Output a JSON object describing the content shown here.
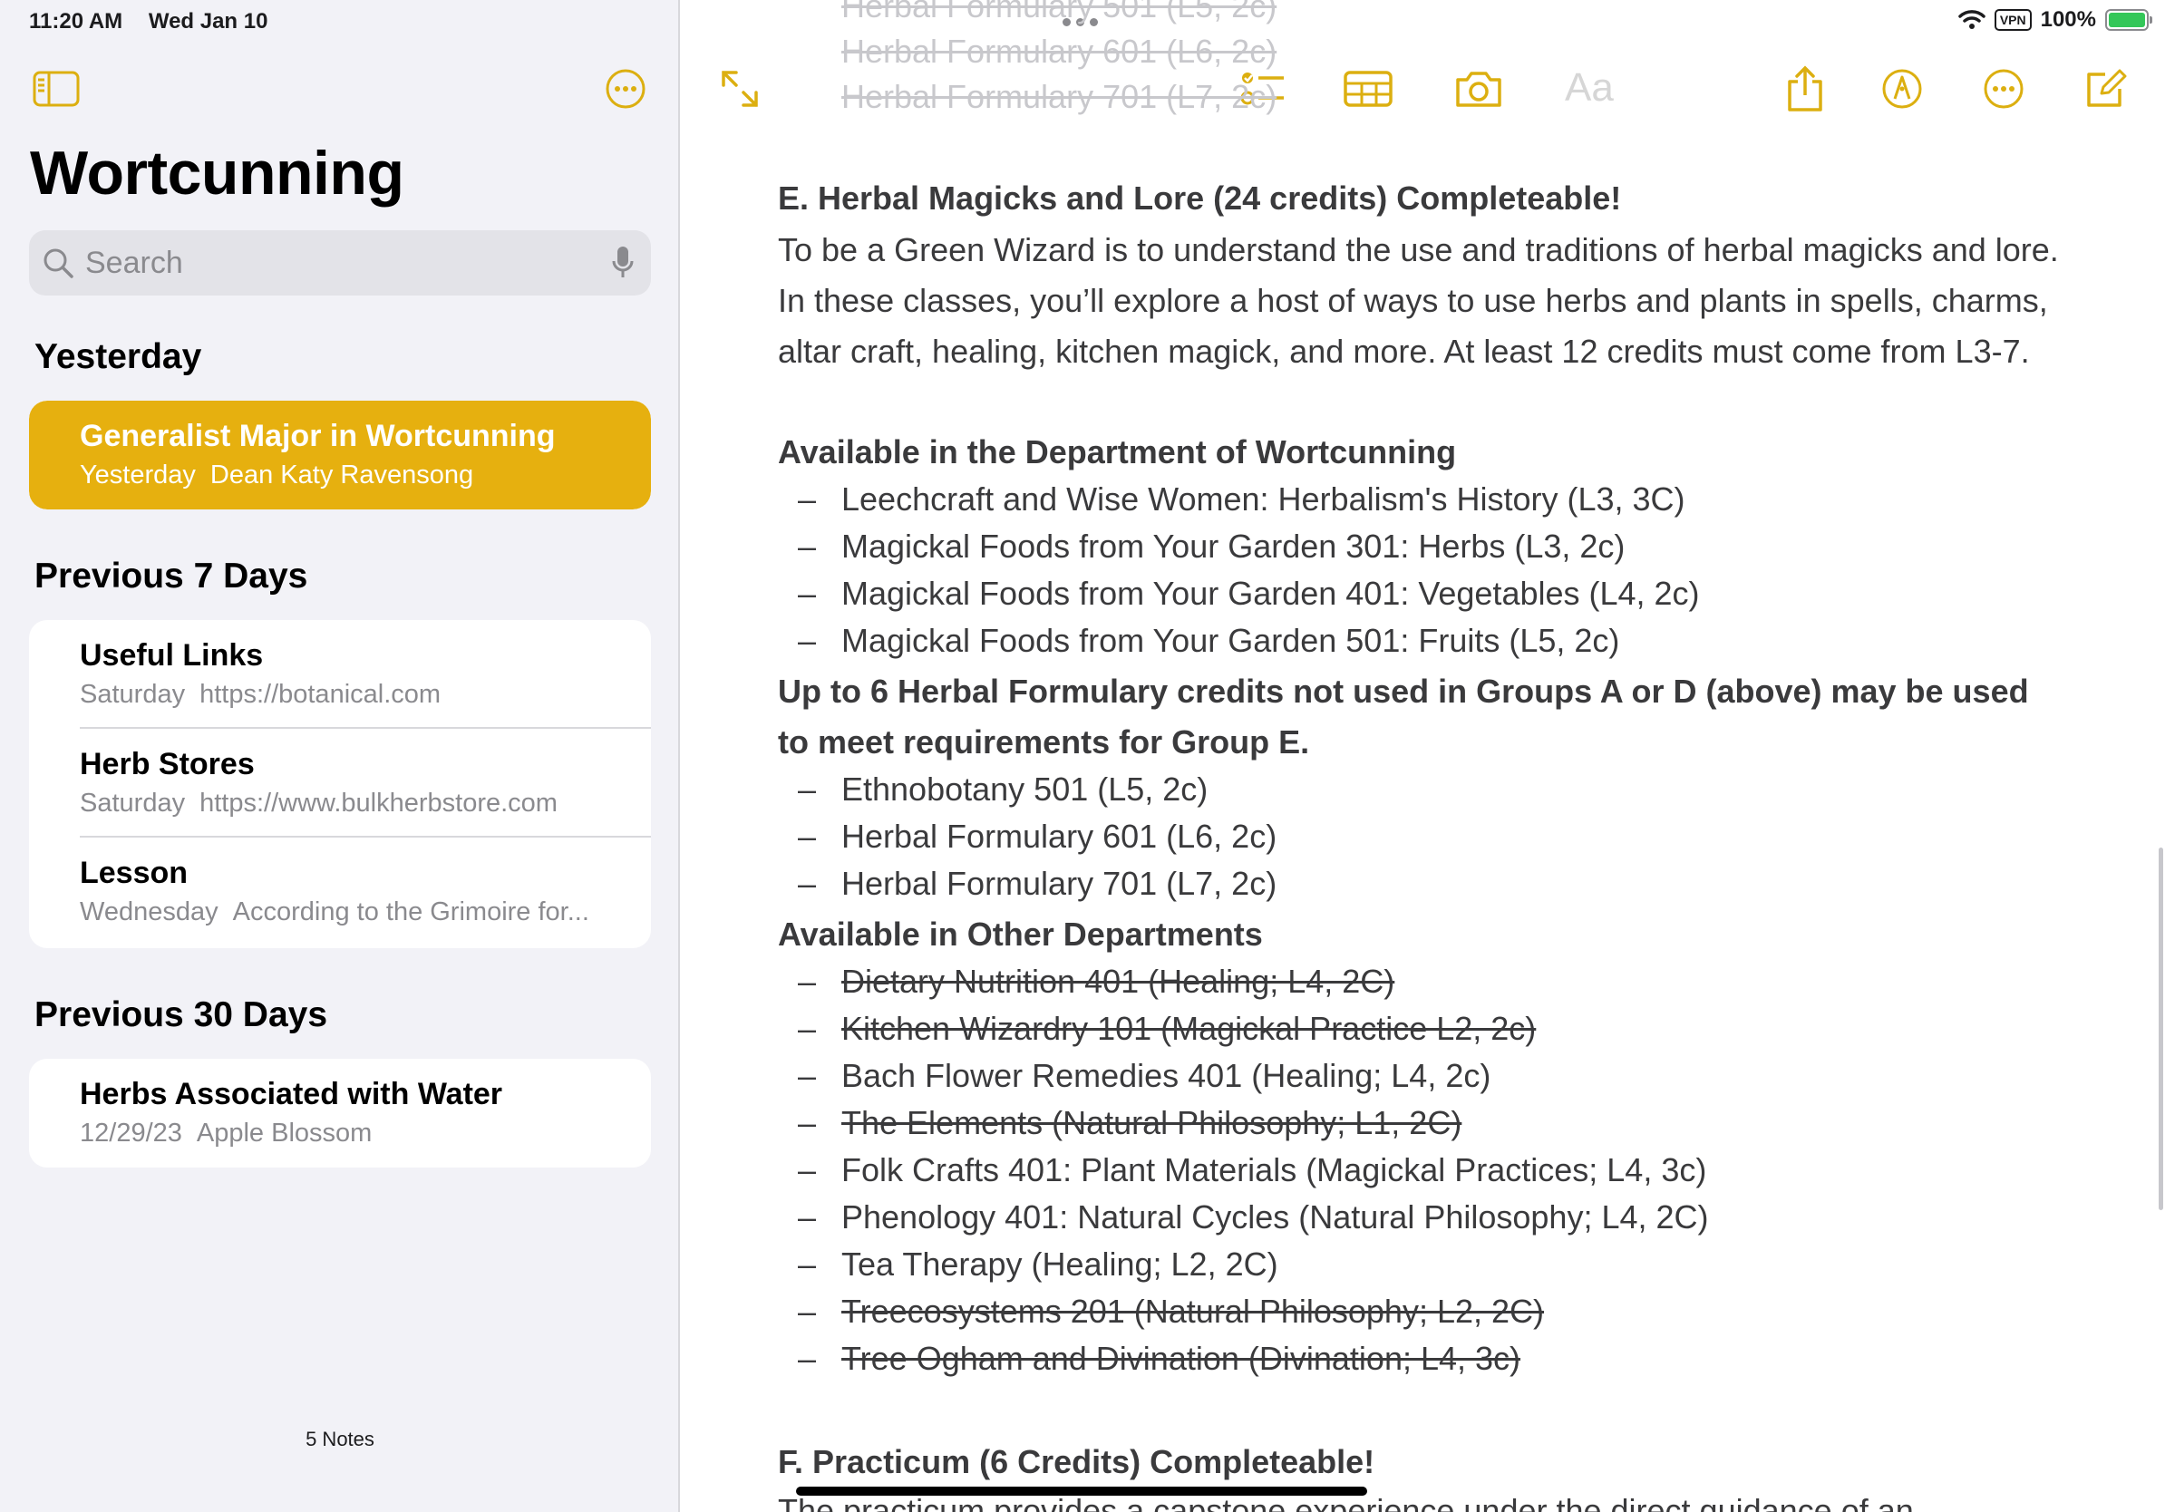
{
  "status": {
    "time": "11:20 AM",
    "date": "Wed Jan 10",
    "vpn": "VPN",
    "battery": "100%"
  },
  "sidebar": {
    "title": "Wortcunning",
    "search_placeholder": "Search",
    "sections": [
      {
        "heading": "Yesterday",
        "notes": [
          {
            "title": "Generalist Major in Wortcunning",
            "date": "Yesterday",
            "preview": "Dean Katy Ravensong",
            "selected": true
          }
        ]
      },
      {
        "heading": "Previous 7 Days",
        "notes": [
          {
            "title": "Useful Links",
            "date": "Saturday",
            "preview": "https://botanical.com"
          },
          {
            "title": "Herb Stores",
            "date": "Saturday",
            "preview": "https://www.bulkherbstore.com"
          },
          {
            "title": "Lesson",
            "date": "Wednesday",
            "preview": "According to the Grimoire for..."
          }
        ]
      },
      {
        "heading": "Previous 30 Days",
        "notes": [
          {
            "title": "Herbs Associated with Water",
            "date": "12/29/23",
            "preview": "Apple Blossom"
          }
        ]
      }
    ],
    "footer": "5 Notes"
  },
  "toolbar": {
    "format_label": "Aa"
  },
  "note": {
    "top_faded": [
      "Herbal Formulary 501 (L5, 2c)",
      "Herbal Formulary 601 (L6, 2c)",
      "Herbal Formulary 701 (L7, 2c)"
    ],
    "section_e_heading": "E. Herbal Magicks and Lore (24 credits) Completeable!",
    "section_e_paragraph": "To be a Green Wizard is to understand the use and traditions of herbal magicks and lore. In these classes, you’ll explore a host of ways to use herbs and plants in spells, charms, altar craft, healing, kitchen magick, and more. At least 12 credits must come from L3-7.",
    "dept_heading": "Available in the Department of Wortcunning",
    "dept_items": [
      {
        "text": "Leechcraft and Wise Women: Herbalism's History (L3, 3C)",
        "struck": false
      },
      {
        "text": "Magickal Foods from Your Garden 301: Herbs (L3, 2c)",
        "struck": false
      },
      {
        "text": "Magickal Foods from Your Garden 401: Vegetables (L4, 2c)",
        "struck": false
      },
      {
        "text": "Magickal Foods from Your Garden 501: Fruits (L5, 2c)",
        "struck": false
      }
    ],
    "formulary_line1": "Up to 6 Herbal Formulary credits not used in Groups A or D (above) may be used",
    "formulary_line2": "to meet requirements for Group E.",
    "formulary_items": [
      {
        "text": "Ethnobotany 501 (L5, 2c)",
        "struck": false
      },
      {
        "text": "Herbal Formulary 601 (L6, 2c)",
        "struck": false
      },
      {
        "text": "Herbal Formulary 701 (L7, 2c)",
        "struck": false
      }
    ],
    "other_heading": "Available in Other Departments",
    "other_items": [
      {
        "text": "Dietary Nutrition 401 (Healing; L4, 2C)",
        "struck": true
      },
      {
        "text": "Kitchen Wizardry 101 (Magickal Practice L2, 2c)",
        "struck": true
      },
      {
        "text": "Bach Flower Remedies 401 (Healing; L4, 2c)",
        "struck": false
      },
      {
        "text": "The Elements (Natural Philosophy; L1, 2C)",
        "struck": true
      },
      {
        "text": "Folk Crafts 401: Plant Materials (Magickal Practices; L4, 3c)",
        "struck": false
      },
      {
        "text": "Phenology 401: Natural Cycles (Natural Philosophy; L4, 2C)",
        "struck": false
      },
      {
        "text": "Tea Therapy (Healing; L2, 2C)",
        "struck": false
      },
      {
        "text": "Treecosystems 201 (Natural Philosophy; L2, 2C)",
        "struck": true
      },
      {
        "text": "Tree Ogham and Divination (Divination; L4, 3c)",
        "struck": true
      }
    ],
    "section_f_heading": "F. Practicum (6 Credits) Completeable!",
    "section_f_partial": "The practicum provides a capstone experience under the direct guidance of an"
  },
  "colors": {
    "accent": "#e6b00f",
    "sidebar_bg": "#f2f2f7",
    "text": "#3a3a3c"
  }
}
